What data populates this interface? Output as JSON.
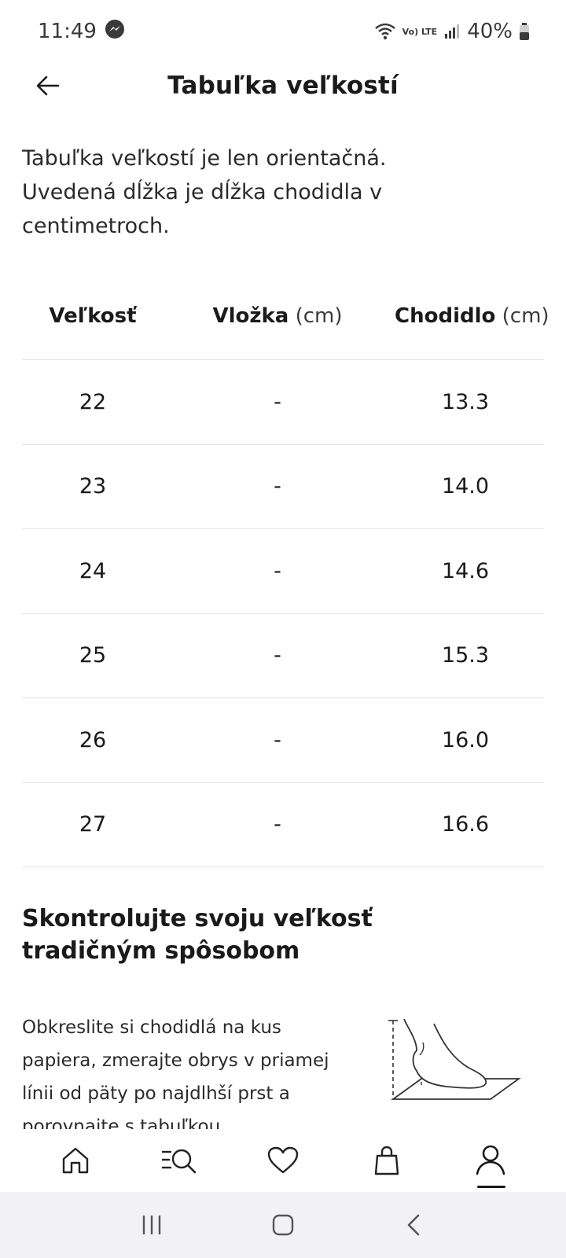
{
  "status_bar": {
    "time": "11:49",
    "battery": "40%",
    "network_label": "Vo) LTE",
    "icons": [
      "messenger-icon",
      "wifi-icon",
      "signal-icon",
      "battery-icon"
    ]
  },
  "header": {
    "title": "Tabuľka veľkostí",
    "back_icon": "arrow-left-icon"
  },
  "intro": {
    "text": "Tabuľka veľkostí je len orientačná.\n Uvedená dĺžka je dĺžka chodidla v\ncentimetroch."
  },
  "table": {
    "columns": [
      {
        "label": "Veľkosť",
        "unit": ""
      },
      {
        "label": "Vložka",
        "unit": " (cm)"
      },
      {
        "label": "Chodidlo",
        "unit": " (cm)"
      }
    ],
    "rows": [
      {
        "size": "22",
        "insole": "-",
        "foot": "13.3"
      },
      {
        "size": "23",
        "insole": "-",
        "foot": "14.0"
      },
      {
        "size": "24",
        "insole": "-",
        "foot": "14.6"
      },
      {
        "size": "25",
        "insole": "-",
        "foot": "15.3"
      },
      {
        "size": "26",
        "insole": "-",
        "foot": "16.0"
      },
      {
        "size": "27",
        "insole": "-",
        "foot": "16.6"
      }
    ]
  },
  "section": {
    "title": "Skontrolujte svoju veľkosť tradičným spôsobom",
    "text": "Obkreslite si chodidlá na kus papiera, zmerajte obrys v priamej línii od päty po najdlhší prst a porovnajte s tabuľkou",
    "illustration": "foot-measure-illustration"
  },
  "bottom_nav": {
    "items": [
      {
        "icon": "home-icon",
        "active": false
      },
      {
        "icon": "search-menu-icon",
        "active": false
      },
      {
        "icon": "heart-icon",
        "active": false
      },
      {
        "icon": "shopping-bag-icon",
        "active": false
      },
      {
        "icon": "user-icon",
        "active": true
      }
    ]
  },
  "system_nav": {
    "icons": [
      "recent-apps-icon",
      "home-button-icon",
      "back-button-icon"
    ]
  },
  "colors": {
    "text": "#1a1a1a",
    "divider": "#e6e6e6",
    "system_nav_bg": "#f2f2f4"
  }
}
